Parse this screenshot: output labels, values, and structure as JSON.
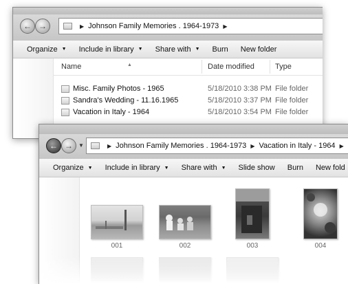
{
  "window1": {
    "breadcrumb": [
      "Johnson Family Memories . 1964-1973"
    ],
    "toolbar": [
      "Organize",
      "Include in library",
      "Share with",
      "Burn",
      "New folder"
    ],
    "columns": {
      "name": "Name",
      "date": "Date modified",
      "type": "Type"
    },
    "rows": [
      {
        "name": "Misc. Family Photos - 1965",
        "date": "5/18/2010 3:38 PM",
        "type": "File folder"
      },
      {
        "name": "Sandra's Wedding - 11.16.1965",
        "date": "5/18/2010 3:37 PM",
        "type": "File folder"
      },
      {
        "name": "Vacation in Italy - 1964",
        "date": "5/18/2010 3:54 PM",
        "type": "File folder"
      }
    ]
  },
  "window2": {
    "breadcrumb": [
      "Johnson Family Memories . 1964-1973",
      "Vacation in Italy - 1964"
    ],
    "toolbar": [
      "Organize",
      "Include in library",
      "Share with",
      "Slide show",
      "Burn",
      "New fold"
    ],
    "thumbnails": [
      {
        "label": "001"
      },
      {
        "label": "002"
      },
      {
        "label": "003"
      },
      {
        "label": "004"
      }
    ]
  },
  "icons": {
    "back": "back-arrow-icon",
    "forward": "forward-arrow-icon",
    "history": "recent-pages-dropdown-icon",
    "folder": "folder-icon",
    "breadcrumb_sep": "chevron-right-icon",
    "dropdown": "caret-down-icon"
  }
}
